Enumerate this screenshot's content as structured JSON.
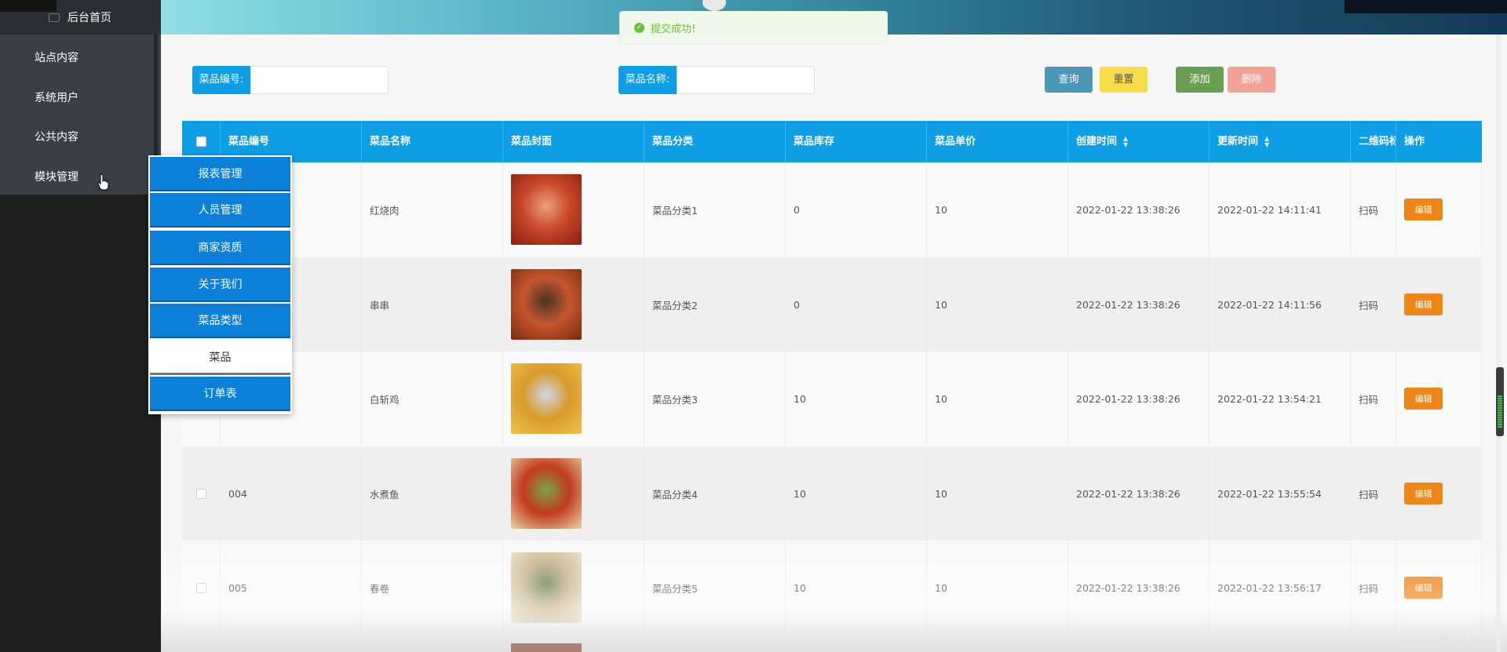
{
  "sidebar": {
    "home_label": "后台首页",
    "items": [
      "站点内容",
      "系统用户",
      "公共内容",
      "模块管理"
    ]
  },
  "toast": {
    "message": "提交成功!"
  },
  "search": {
    "field1_label": "菜品编号:",
    "field2_label": "菜品名称:",
    "query_button": "查询",
    "reset_button": "重置",
    "add_button": "添加",
    "delete_button": "删除"
  },
  "table": {
    "headers": [
      "菜品编号",
      "菜品名称",
      "菜品封面",
      "菜品分类",
      "菜品库存",
      "菜品单价",
      "创建时间",
      "更新时间",
      "二维码标",
      "操作"
    ],
    "rows": [
      {
        "id": "",
        "name": "红烧肉",
        "category": "菜品分类1",
        "stock": "0",
        "price": "10",
        "created": "2022-01-22 13:38:26",
        "updated": "2022-01-22 14:11:41",
        "qr": "扫码",
        "action": "编辑"
      },
      {
        "id": "",
        "name": "串串",
        "category": "菜品分类2",
        "stock": "0",
        "price": "10",
        "created": "2022-01-22 13:38:26",
        "updated": "2022-01-22 14:11:56",
        "qr": "扫码",
        "action": "编辑"
      },
      {
        "id": "",
        "name": "白斩鸡",
        "category": "菜品分类3",
        "stock": "10",
        "price": "10",
        "created": "2022-01-22 13:38:26",
        "updated": "2022-01-22 13:54:21",
        "qr": "扫码",
        "action": "编辑"
      },
      {
        "id": "004",
        "name": "水煮鱼",
        "category": "菜品分类4",
        "stock": "10",
        "price": "10",
        "created": "2022-01-22 13:38:26",
        "updated": "2022-01-22 13:55:54",
        "qr": "扫码",
        "action": "编辑"
      },
      {
        "id": "005",
        "name": "春卷",
        "category": "菜品分类5",
        "stock": "10",
        "price": "10",
        "created": "2022-01-22 13:38:26",
        "updated": "2022-01-22 13:56:17",
        "qr": "扫码",
        "action": "编辑"
      }
    ]
  },
  "dropdown": {
    "items": [
      "报表管理",
      "人员管理",
      "商家资质",
      "关于我们",
      "菜品类型",
      "菜品",
      "订单表"
    ],
    "active_index": 5
  },
  "watermark": "CSDN @FYKJ_2010",
  "colors": {
    "table_header": "#0e9ee6",
    "query_btn": "#4a97b7",
    "reset_btn": "#f9dc4a",
    "add_btn": "#6b9e55",
    "delete_btn": "#f4a297",
    "edit_btn": "#f08518",
    "menu_item": "#0c80d8"
  }
}
